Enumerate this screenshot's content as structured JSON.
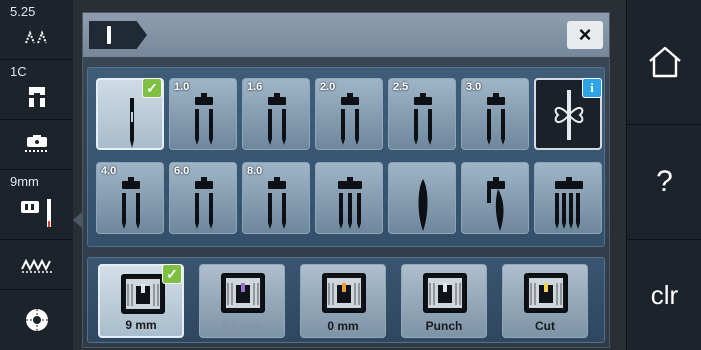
{
  "left_panel": {
    "items": [
      {
        "text": "5.25",
        "icon": "stitch-pattern-icon"
      },
      {
        "text": "1C",
        "icon": "presser-foot-icon"
      },
      {
        "text": "",
        "icon": "bobbin-thread-icon"
      },
      {
        "text": "9mm",
        "icon": "stitch-plate-icon"
      },
      {
        "text": "",
        "icon": "stitch-width-icon"
      },
      {
        "text": "",
        "icon": "spool-icon"
      }
    ]
  },
  "header": {
    "tab_icon": "needle-tab-icon",
    "close_label": "×"
  },
  "needles": [
    {
      "label": "",
      "type": "single",
      "selected": true
    },
    {
      "label": "1.0",
      "type": "twin"
    },
    {
      "label": "1.6",
      "type": "twin"
    },
    {
      "label": "2.0",
      "type": "twin"
    },
    {
      "label": "2.5",
      "type": "twin"
    },
    {
      "label": "3.0",
      "type": "twin"
    },
    {
      "label": "",
      "type": "needle-threader-info",
      "info": "i"
    },
    {
      "label": "4.0",
      "type": "twin"
    },
    {
      "label": "6.0",
      "type": "twin"
    },
    {
      "label": "8.0",
      "type": "twin"
    },
    {
      "label": "",
      "type": "triple"
    },
    {
      "label": "",
      "type": "wing"
    },
    {
      "label": "",
      "type": "single-blade"
    },
    {
      "label": "",
      "type": "quad"
    }
  ],
  "stitch_plates": [
    {
      "label": "9 mm",
      "selected": true,
      "dim": false
    },
    {
      "label": "5,5 mm",
      "selected": false,
      "dim": true
    },
    {
      "label": "0 mm",
      "selected": false,
      "dim": false
    },
    {
      "label": "Punch",
      "selected": false,
      "dim": false
    },
    {
      "label": "Cut",
      "selected": false,
      "dim": false
    }
  ],
  "right_panel": {
    "home_icon": "home-icon",
    "help_label": "?",
    "clear_label": "clr"
  },
  "colors": {
    "check": "#7ec142",
    "info": "#2da3e8"
  }
}
